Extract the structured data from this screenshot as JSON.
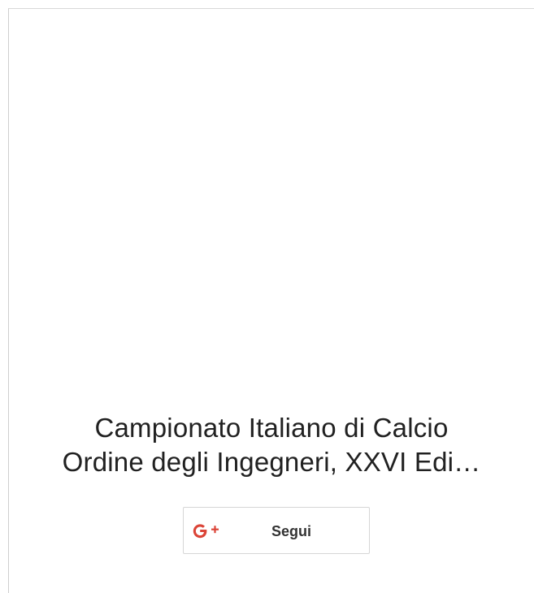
{
  "card": {
    "title_line_1": "Campionato Italiano di Calcio",
    "title_line_2": "Ordine degli Ingegneri, XXVI Edi…"
  },
  "follow_button": {
    "icon": "google-plus-icon",
    "label": "Segui"
  },
  "colors": {
    "google_red": "#DB4437",
    "text": "#212121",
    "border": "#D6D6D6"
  }
}
